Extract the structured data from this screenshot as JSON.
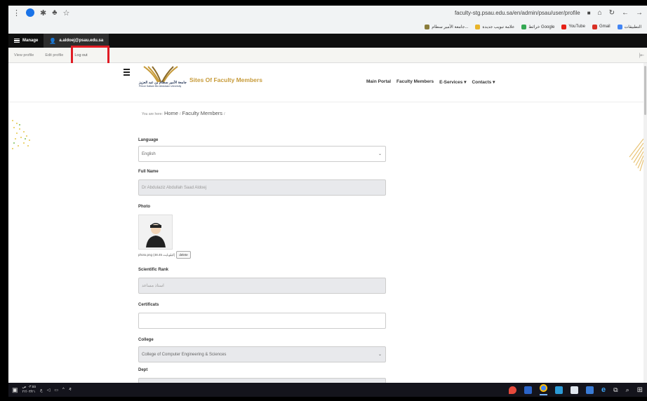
{
  "browser": {
    "url": "faculty-stg.psau.edu.sa/en/admin/psau/user/profile",
    "bookmarks": [
      "التطبيقات",
      "Gmail",
      "YouTube",
      "خرائط Google",
      "علامة تبويب جديدة",
      "جامعة الأمير سطام..."
    ]
  },
  "admin": {
    "manage_label": "Manage",
    "user_label": "a.aldoej@psau.edu.sa",
    "tabs": [
      "View profile",
      "Edit profile",
      "Log out"
    ]
  },
  "site": {
    "logo_ar": "جامعة الأمير سطام بن عبد العزيز",
    "logo_en": "Prince Sattam Bin Abdulaziz University",
    "title": "Sites Of Faculty Members",
    "nav": [
      "Main Portal",
      "Faculty Members",
      "E-Services ▾",
      "Contacts ▾"
    ]
  },
  "breadcrumb": {
    "prefix": "You are here:",
    "home": "Home",
    "sep": "/",
    "current": "Faculty Members",
    "trail_sep": "/"
  },
  "form": {
    "language_label": "Language",
    "language_value": "English",
    "fullname_label": "Full Name",
    "fullname_value": "Dr Abdulaziz Abdullah Saad Aldoej",
    "photo_label": "Photo",
    "photo_file": "photo.png (48.45 كيلوبايت)",
    "delete_label": "delete",
    "rank_label": "Scientific Rank",
    "rank_value": "استاذ مساعد",
    "cert_label": "Certificats",
    "cert_value": "",
    "college_label": "College",
    "college_value": "College of Computer Engineering & Sciences",
    "dept_label": "Dept"
  },
  "taskbar": {
    "time": "٠٣:٥٥ ص",
    "date": "٢٢/٠٣/٢١",
    "lang": "ع"
  },
  "colors": {
    "highlight": "#e01b24",
    "brand_gold": "#c79b3a",
    "admin_bar": "#0f0f0f"
  }
}
